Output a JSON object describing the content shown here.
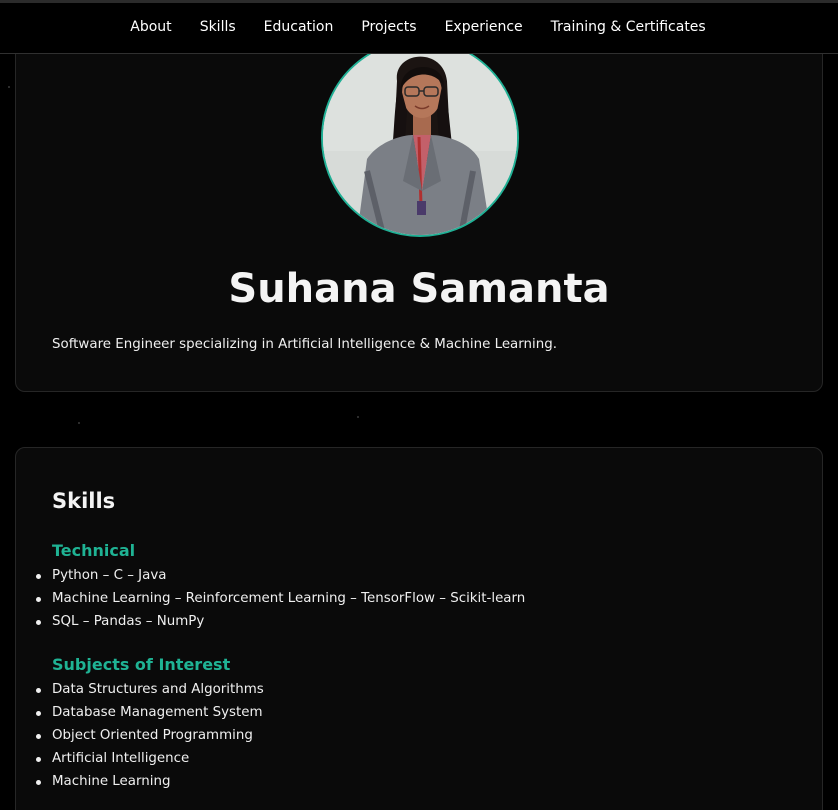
{
  "nav": {
    "items": [
      {
        "label": "About"
      },
      {
        "label": "Skills"
      },
      {
        "label": "Education"
      },
      {
        "label": "Projects"
      },
      {
        "label": "Experience"
      },
      {
        "label": "Training & Certificates"
      }
    ]
  },
  "profile": {
    "name": "Suhana Samanta",
    "tagline": "Software Engineer specializing in Artificial Intelligence & Machine Learning.",
    "photo_icon": "profile-photo"
  },
  "skills": {
    "title": "Skills",
    "technical": {
      "heading": "Technical",
      "items": [
        "Python – C – Java",
        "Machine Learning – Reinforcement Learning – TensorFlow – Scikit-learn",
        "SQL – Pandas – NumPy"
      ]
    },
    "interests": {
      "heading": "Subjects of Interest",
      "items": [
        "Data Structures and Algorithms",
        "Database Management System",
        "Object Oriented Programming",
        "Artificial Intelligence",
        "Machine Learning"
      ]
    }
  },
  "colors": {
    "accent": "#1fb394",
    "background": "#000000",
    "card": "#0a0a0a",
    "text": "#f0f0f0"
  }
}
